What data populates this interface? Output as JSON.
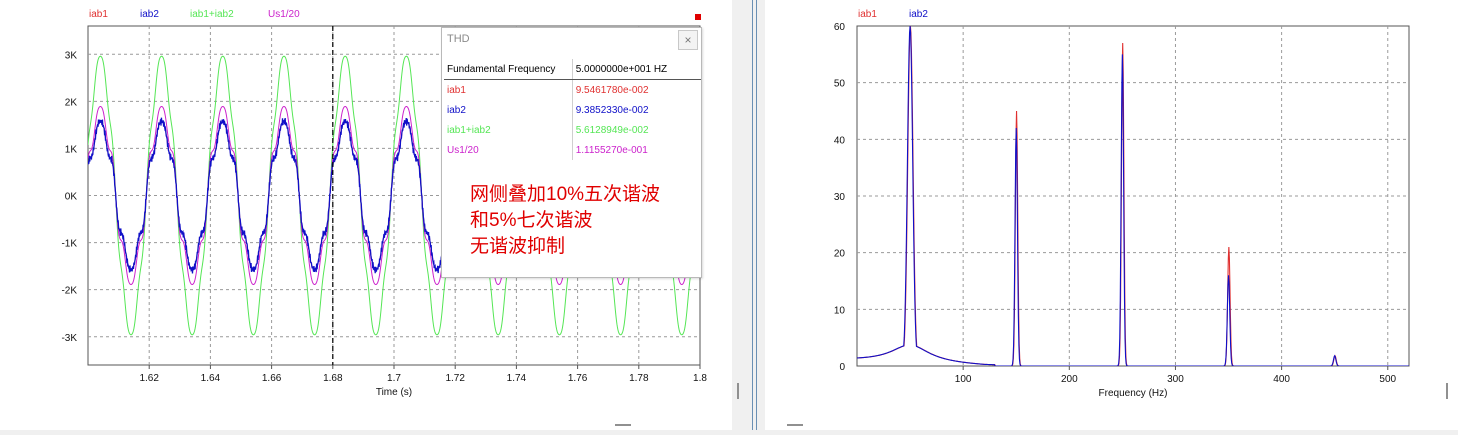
{
  "colors": {
    "iab1": "#e03030",
    "iab2": "#1010c8",
    "sum": "#55e655",
    "us": "#cc22cc",
    "annotation": "#e00000"
  },
  "left_legend": [
    "iab1",
    "iab2",
    "iab1+iab2",
    "Us1/20"
  ],
  "right_legend": [
    "iab1",
    "iab2"
  ],
  "thd": {
    "title": "THD",
    "close_label": "×",
    "header": {
      "name": "Fundamental Frequency",
      "value": "5.0000000e+001 HZ"
    },
    "rows": [
      {
        "name": "iab1",
        "value": "9.5461780e-002",
        "color": "#e03030"
      },
      {
        "name": "iab2",
        "value": "9.3852330e-002",
        "color": "#1010c8"
      },
      {
        "name": "iab1+iab2",
        "value": "5.6128949e-002",
        "color": "#55e655"
      },
      {
        "name": "Us1/20",
        "value": "1.1155270e-001",
        "color": "#cc22cc"
      }
    ]
  },
  "annotation": [
    "网侧叠加10%五次谐波",
    "和5%七次谐波",
    "无谐波抑制"
  ],
  "chart_data": [
    {
      "type": "line",
      "xlabel": "Time (s)",
      "ylabel": "",
      "xlim": [
        1.6,
        1.8
      ],
      "ylim": [
        -3.6,
        3.6
      ],
      "x_ticks": [
        1.62,
        1.64,
        1.66,
        1.68,
        1.7,
        1.72,
        1.74,
        1.76,
        1.78,
        1.8
      ],
      "x_tick_labels": [
        "1.62",
        "1.64",
        "1.66",
        "1.68",
        "1.7",
        "1.72",
        "1.74",
        "1.76",
        "1.78",
        "1.8"
      ],
      "y_ticks": [
        3,
        2,
        1,
        0,
        -1,
        -2,
        -3
      ],
      "y_tick_labels": [
        "3K",
        "2K",
        "1K",
        "0K",
        "-1K",
        "-2K",
        "-3K"
      ],
      "grid": true,
      "cursor_x": 1.68,
      "fundamental_hz": 50,
      "series": [
        {
          "name": "iab1",
          "amplitude": 1.5,
          "harmonics": [
            {
              "h": 5,
              "a": 0.1
            },
            {
              "h": 7,
              "a": 0.05
            }
          ]
        },
        {
          "name": "iab2",
          "amplitude": 1.5,
          "harmonics": [
            {
              "h": 5,
              "a": 0.1
            },
            {
              "h": 7,
              "a": 0.05
            }
          ]
        },
        {
          "name": "iab1+iab2",
          "amplitude": 2.9,
          "harmonics": [
            {
              "h": 5,
              "a": 0.05
            },
            {
              "h": 7,
              "a": 0.03
            }
          ]
        },
        {
          "name": "Us1/20",
          "amplitude": 1.8,
          "harmonics": [
            {
              "h": 5,
              "a": 0.1
            },
            {
              "h": 7,
              "a": 0.05
            }
          ]
        }
      ]
    },
    {
      "type": "line",
      "xlabel": "Frequency (Hz)",
      "ylabel": "",
      "xlim": [
        0,
        520
      ],
      "ylim": [
        0,
        60
      ],
      "x_ticks": [
        100,
        200,
        300,
        400,
        500
      ],
      "x_tick_labels": [
        "100",
        "200",
        "300",
        "400",
        "500"
      ],
      "y_ticks": [
        0,
        10,
        20,
        30,
        40,
        50,
        60
      ],
      "y_tick_labels": [
        "0",
        "10",
        "20",
        "30",
        "40",
        "50",
        "60"
      ],
      "grid": true,
      "series": [
        {
          "name": "iab1",
          "peaks": [
            {
              "x": 50,
              "y": 60
            },
            {
              "x": 150,
              "y": 45
            },
            {
              "x": 250,
              "y": 57
            },
            {
              "x": 350,
              "y": 21
            },
            {
              "x": 450,
              "y": 1.8
            }
          ]
        },
        {
          "name": "iab2",
          "peaks": [
            {
              "x": 50,
              "y": 60
            },
            {
              "x": 150,
              "y": 42
            },
            {
              "x": 250,
              "y": 55
            },
            {
              "x": 350,
              "y": 16
            },
            {
              "x": 450,
              "y": 1.8
            }
          ]
        }
      ]
    }
  ]
}
